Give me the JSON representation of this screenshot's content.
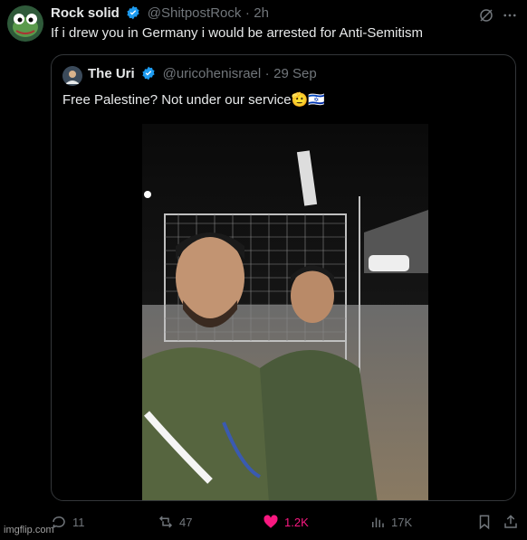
{
  "post": {
    "author_name": "Rock solid",
    "author_handle": "@ShitpostRock",
    "separator": "·",
    "time": "2h",
    "text": "If i drew you in Germany i would be arrested for Anti-Semitism"
  },
  "quote": {
    "author_name": "The Uri",
    "author_handle": "@uricohenisrael",
    "separator": "·",
    "date": "29 Sep",
    "text": "Free Palestine? Not under our service",
    "emoji": "🫡🇮🇱"
  },
  "actions": {
    "replies": "11",
    "reposts": "47",
    "likes": "1.2K",
    "views": "17K"
  },
  "watermark": "imgflip.com",
  "colors": {
    "verified": "#1d9bf0",
    "like": "#f91880",
    "muted": "#71767b"
  }
}
